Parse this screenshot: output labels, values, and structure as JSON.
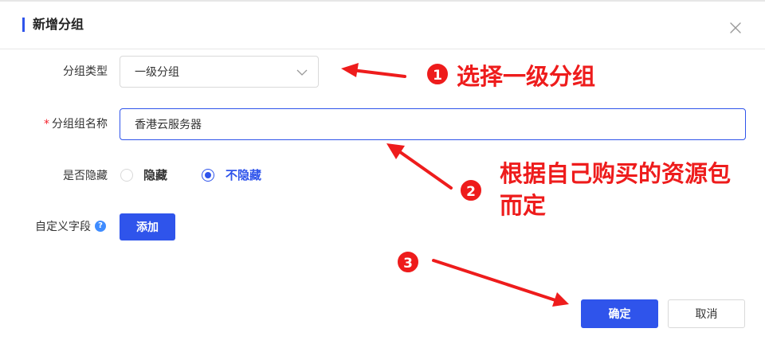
{
  "dialog": {
    "title": "新增分组"
  },
  "form": {
    "group_type": {
      "label": "分组类型",
      "value": "一级分组"
    },
    "group_name": {
      "required_mark": "*",
      "label": "分组组名称",
      "value": "香港云服务器"
    },
    "hidden": {
      "label": "是否隐藏",
      "options": [
        {
          "label": "隐藏",
          "checked": false
        },
        {
          "label": "不隐藏",
          "checked": true
        }
      ]
    },
    "custom_fields": {
      "label": "自定义字段",
      "help_glyph": "?",
      "add_label": "添加"
    }
  },
  "footer": {
    "confirm_label": "确定",
    "cancel_label": "取消"
  },
  "annotations": [
    {
      "number": "1",
      "text": "选择一级分组"
    },
    {
      "number": "2",
      "line1": "根据自己购买的资源包",
      "line2": "而定"
    },
    {
      "number": "3"
    }
  ],
  "colors": {
    "primary": "#2f54eb",
    "annotation_red": "#ee1c1c",
    "required_red": "#f5222d",
    "help_blue": "#3f8cff"
  },
  "icons": {
    "close": "close-icon",
    "select_chevron": "chevron-down-icon",
    "help": "question-circle-icon"
  }
}
